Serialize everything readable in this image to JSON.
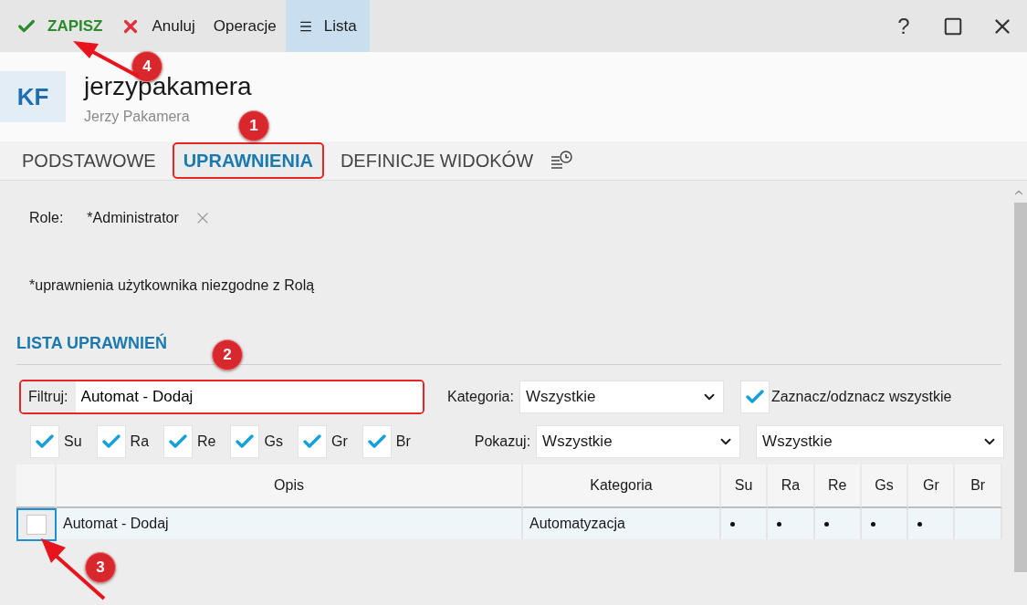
{
  "toolbar": [
    {
      "kind": "save",
      "label": "ZAPISZ",
      "selected": false
    },
    {
      "kind": "cancel",
      "label": "Anuluj",
      "selected": false
    },
    {
      "kind": "plain",
      "label": "Operacje",
      "selected": false
    },
    {
      "kind": "list",
      "label": "Lista",
      "selected": true
    }
  ],
  "window_controls": {
    "help": "?"
  },
  "header": {
    "avatar": "KF",
    "title": "jerzypakamera",
    "subtitle": "Jerzy Pakamera"
  },
  "tabs": [
    {
      "label": "PODSTAWOWE",
      "selected": false,
      "highlighted": false
    },
    {
      "label": "UPRAWNIENIA",
      "selected": true,
      "highlighted": true
    },
    {
      "label": "DEFINICJE WIDOKÓW",
      "selected": false,
      "highlighted": false
    }
  ],
  "role": {
    "label": "Role:",
    "value": "*Administrator"
  },
  "note": "*uprawnienia użytkownika niezgodne z Rolą",
  "section_title": "LISTA UPRAWNIEŃ",
  "filter": {
    "label": "Filtruj:",
    "value": "Automat - Dodaj",
    "highlighted": true
  },
  "category": {
    "label": "Kategoria:",
    "value": "Wszystkie"
  },
  "select_all": {
    "label": "Zaznacz/odznacz wszystkie",
    "checked": true
  },
  "column_toggles": [
    {
      "label": "Su",
      "checked": true
    },
    {
      "label": "Ra",
      "checked": true
    },
    {
      "label": "Re",
      "checked": true
    },
    {
      "label": "Gs",
      "checked": true
    },
    {
      "label": "Gr",
      "checked": true
    },
    {
      "label": "Br",
      "checked": true
    }
  ],
  "show": {
    "label": "Pokazuj:",
    "value": "Wszystkie",
    "second_value": "Wszystkie"
  },
  "table": {
    "columns": [
      "Opis",
      "Kategoria",
      "Su",
      "Ra",
      "Re",
      "Gs",
      "Gr",
      "Br"
    ],
    "rows": [
      {
        "checked": false,
        "selected": true,
        "description": "Automat - Dodaj",
        "category": "Automatyzacja",
        "marks": [
          true,
          true,
          true,
          true,
          true,
          false
        ]
      }
    ]
  },
  "annotations": [
    {
      "label": "1"
    },
    {
      "label": "2"
    },
    {
      "label": "3"
    },
    {
      "label": "4"
    }
  ]
}
